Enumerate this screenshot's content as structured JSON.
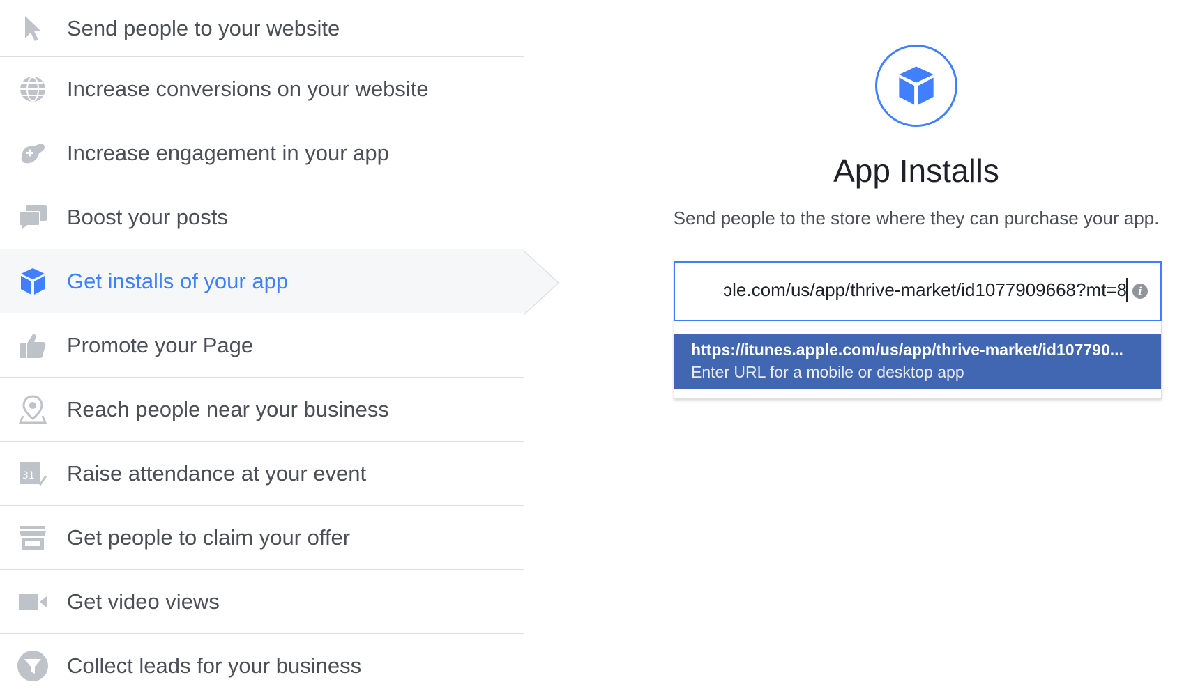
{
  "sidebar": {
    "items": [
      {
        "label": "Send people to your website",
        "icon": "cursor-icon"
      },
      {
        "label": "Increase conversions on your website",
        "icon": "globe-icon"
      },
      {
        "label": "Increase engagement in your app",
        "icon": "gamepad-icon"
      },
      {
        "label": "Boost your posts",
        "icon": "speech-bubbles-icon"
      },
      {
        "label": "Get installs of your app",
        "icon": "cube-icon"
      },
      {
        "label": "Promote your Page",
        "icon": "thumbs-up-icon"
      },
      {
        "label": "Reach people near your business",
        "icon": "map-pin-icon"
      },
      {
        "label": "Raise attendance at your event",
        "icon": "calendar-icon"
      },
      {
        "label": "Get people to claim your offer",
        "icon": "storefront-icon"
      },
      {
        "label": "Get video views",
        "icon": "video-camera-icon"
      },
      {
        "label": "Collect leads for your business",
        "icon": "funnel-icon"
      }
    ],
    "selected_label": "Get installs of your app"
  },
  "main": {
    "title": "App Installs",
    "subtitle": "Send people to the store where they can purchase your app.",
    "url_input_value": "ɔle.com/us/app/thrive-market/id1077909668?mt=8",
    "dropdown": {
      "primary": "https://itunes.apple.com/us/app/thrive-market/id107790...",
      "secondary": "Enter URL for a mobile or desktop app"
    }
  },
  "colors": {
    "accent": "#4080ff",
    "selected_bg": "#f6f7f9",
    "dropdown_highlight": "#4267b2",
    "icon_gray": "#bec2c9",
    "text": "#4b4f56"
  }
}
